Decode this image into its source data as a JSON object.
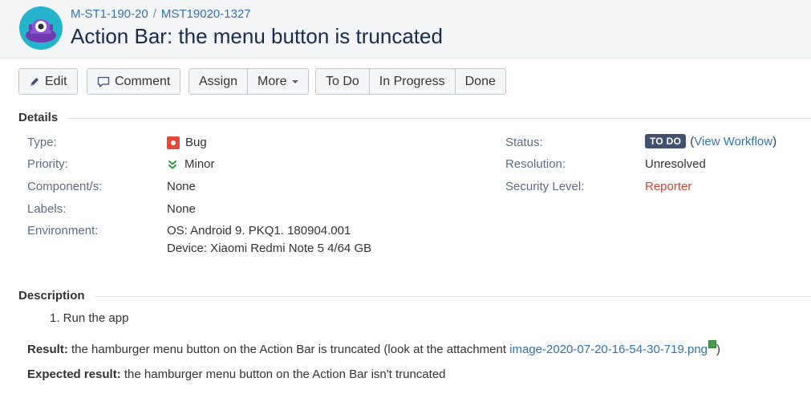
{
  "header": {
    "breadcrumbs": [
      "M-ST1-190-20",
      "MST19020-1327"
    ],
    "breadcrumb_separator": "/",
    "summary": "Action Bar: the menu button is truncated",
    "avatar_icon": "project-avatar-icon"
  },
  "toolbar": {
    "edit": "Edit",
    "comment": "Comment",
    "assign": "Assign",
    "more": "More",
    "todo": "To Do",
    "in_progress": "In Progress",
    "done": "Done"
  },
  "details": {
    "heading": "Details",
    "type_label": "Type:",
    "type_value": "Bug",
    "priority_label": "Priority:",
    "priority_value": "Minor",
    "components_label": "Component/s:",
    "components_value": "None",
    "labels_label": "Labels:",
    "labels_value": "None",
    "environment_label": "Environment:",
    "environment_line1": "OS: Android 9. PKQ1. 180904.001",
    "environment_line2": "Device: Xiaomi Redmi Note 5 4/64 GB",
    "status_label": "Status:",
    "status_value": "TO DO",
    "view_workflow": "View Workflow",
    "resolution_label": "Resolution:",
    "resolution_value": "Unresolved",
    "security_label": "Security Level:",
    "security_value": "Reporter"
  },
  "description": {
    "heading": "Description",
    "step1": "1. Run the app",
    "result_label": "Result:",
    "result_text": " the hamburger menu button on the Action Bar is truncated (look at the attachment ",
    "result_link": "image-2020-07-20-16-54-30-719.png",
    "result_close": ")",
    "expected_label": "Expected result:",
    "expected_text": " the hamburger menu button on the Action Bar isn't truncated"
  },
  "colors": {
    "link": "#3572b0",
    "status_lozenge": "#42526e",
    "bug": "#e5493a",
    "priority_minor": "#2a9d3a",
    "reporter": "#d04437"
  }
}
